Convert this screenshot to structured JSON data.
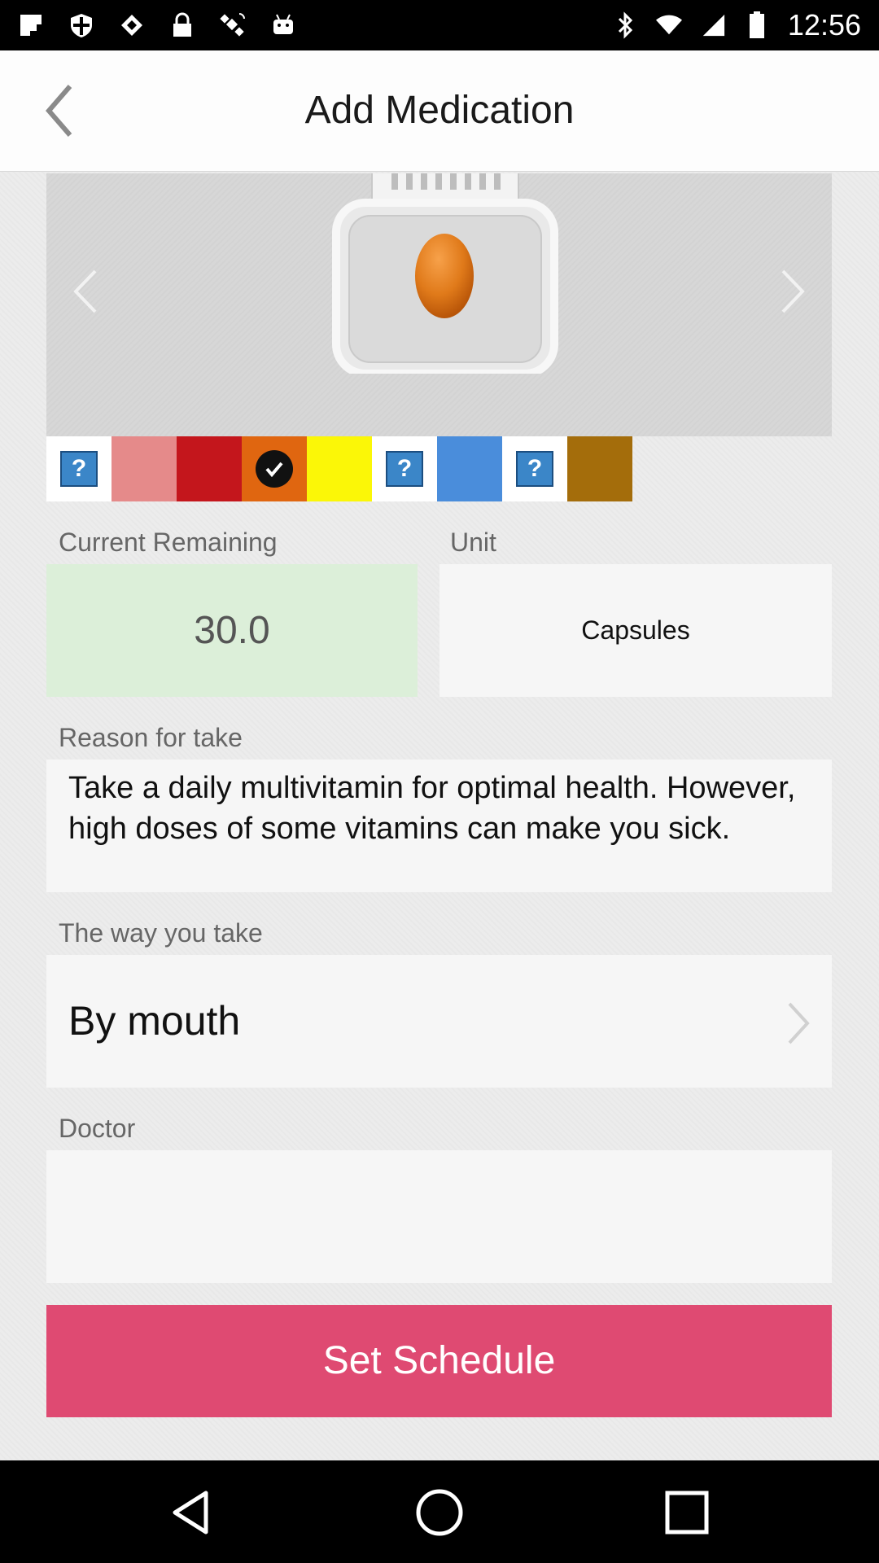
{
  "status_bar": {
    "time": "12:56",
    "left_icons": [
      "flipboard-icon",
      "shield-icon",
      "diamond-icon",
      "lock-icon",
      "satellite-icon",
      "android-icon"
    ],
    "right_icons": [
      "bluetooth-icon",
      "wifi-icon",
      "signal-icon",
      "battery-icon"
    ]
  },
  "header": {
    "title": "Add Medication"
  },
  "swatches": [
    {
      "color": "#ffffff",
      "icon": "question-icon",
      "selected": false
    },
    {
      "color": "#e58a8a",
      "icon": null,
      "selected": false
    },
    {
      "color": "#c4161c",
      "icon": null,
      "selected": false
    },
    {
      "color": "#e06610",
      "icon": "check-icon",
      "selected": true
    },
    {
      "color": "#fbf707",
      "icon": null,
      "selected": false
    },
    {
      "color": "#ffffff",
      "icon": "question-icon",
      "selected": false
    },
    {
      "color": "#4a8ddb",
      "icon": null,
      "selected": false
    },
    {
      "color": "#ffffff",
      "icon": "question-icon",
      "selected": false
    },
    {
      "color": "#a46d0b",
      "icon": null,
      "selected": false
    }
  ],
  "form": {
    "current_remaining_label": "Current Remaining",
    "current_remaining_value": "30.0",
    "unit_label": "Unit",
    "unit_value": "Capsules",
    "reason_label": "Reason for take",
    "reason_value": "Take a daily multivitamin for optimal health. However, high doses of some vitamins can make you sick.",
    "way_label": "The way you take",
    "way_value": "By mouth",
    "doctor_label": "Doctor",
    "doctor_value": ""
  },
  "actions": {
    "set_schedule_label": "Set Schedule"
  },
  "colors": {
    "accent": "#df4a72",
    "remaining_bg": "#dcefd9",
    "pill": "#e07a1a"
  }
}
